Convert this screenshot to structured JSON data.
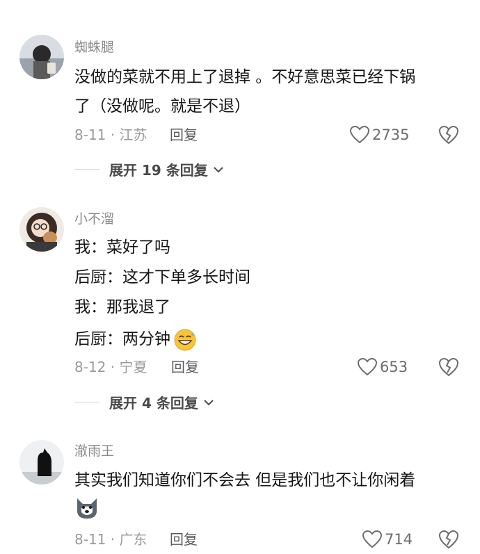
{
  "comments": [
    {
      "username": "蜘蛛腿",
      "lines": [
        "没做的菜就不用上了退掉 。不好意思菜已经下锅",
        "了（没做呢。就是不退）"
      ],
      "date_region": "8-11 · 江苏",
      "reply_label": "回复",
      "likes": "2735",
      "expand_label": "展开 19 条回复",
      "avatar_icon": "user-avatar-icon"
    },
    {
      "username": "小不溜",
      "lines": [
        "我：菜好了吗",
        "后厨：这才下单多长时间",
        "我：那我退了",
        "后厨：两分钟"
      ],
      "date_region": "8-12 · 宁夏",
      "reply_label": "回复",
      "likes": "653",
      "expand_label": "展开 4 条回复",
      "avatar_icon": "user-avatar-icon"
    },
    {
      "username": "澈雨王",
      "lines": [
        "其实我们知道你们不会去 但是我们也不让你闲着"
      ],
      "date_region": "8-11 · 广东",
      "reply_label": "回复",
      "likes": "714",
      "avatar_icon": "user-avatar-icon"
    }
  ],
  "colors": {
    "text": "#161616",
    "muted": "#9a9a9a",
    "divider": "#d4d4d4"
  }
}
